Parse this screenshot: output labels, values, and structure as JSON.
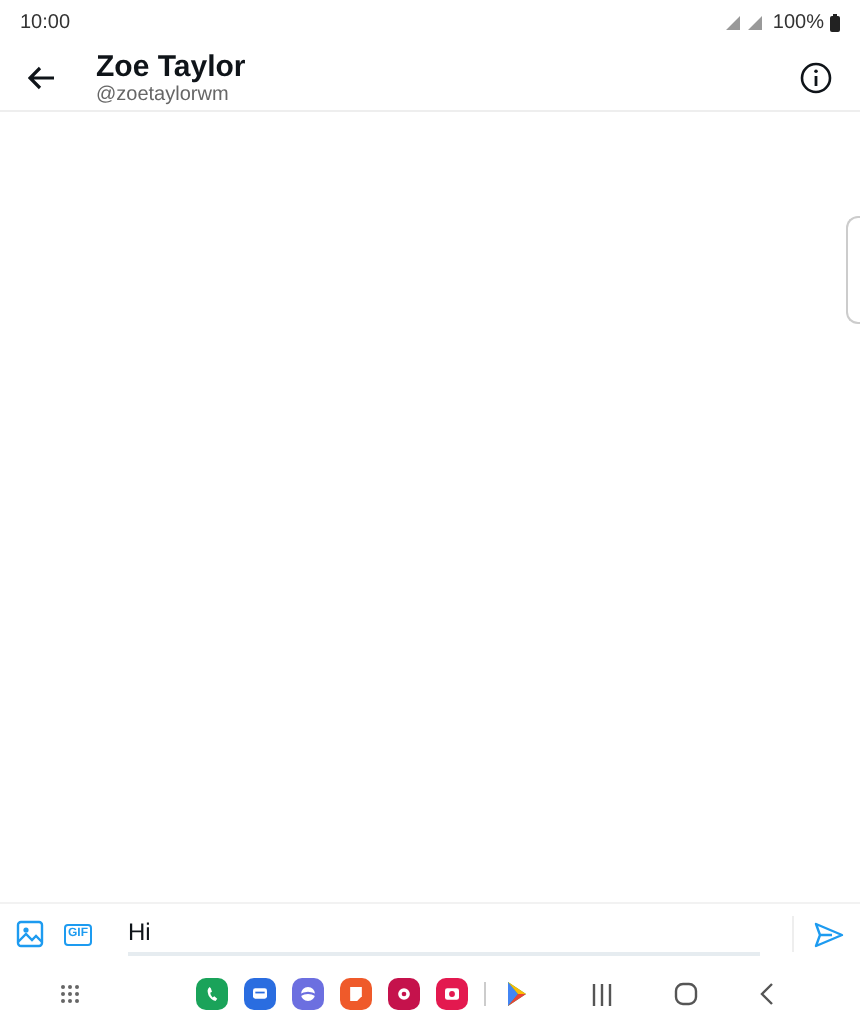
{
  "status_bar": {
    "time": "10:00",
    "battery": "100%"
  },
  "header": {
    "name": "Zoe Taylor",
    "handle": "@zoetaylorwm"
  },
  "composer": {
    "gif_label": "GIF",
    "value": "Hi"
  },
  "dock": [
    {
      "color": "#1aa35a"
    },
    {
      "color": "#2a6de0"
    },
    {
      "color": "#6c6fe0"
    },
    {
      "color": "#ef5a2a"
    },
    {
      "color": "#c5124c"
    },
    {
      "color": "#e3194f"
    }
  ]
}
